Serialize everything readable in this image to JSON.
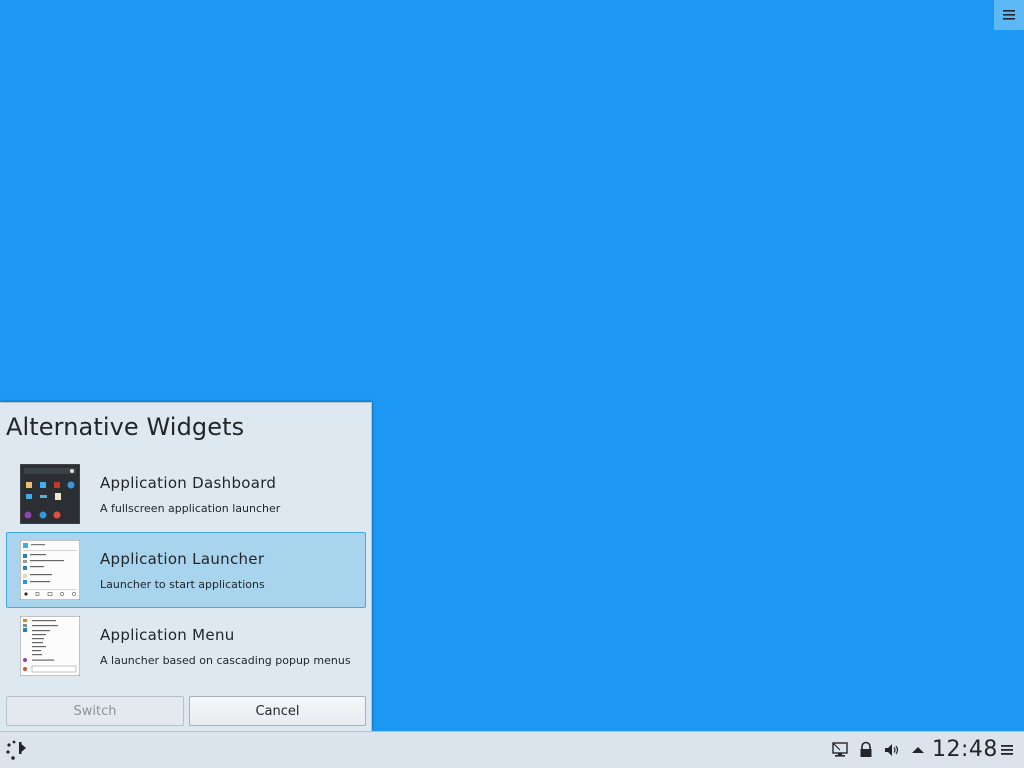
{
  "popup": {
    "title": "Alternative Widgets",
    "items": [
      {
        "name": "Application Dashboard",
        "description": "A fullscreen application launcher",
        "selected": false
      },
      {
        "name": "Application Launcher",
        "description": "Launcher to start applications",
        "selected": true
      },
      {
        "name": "Application Menu",
        "description": "A launcher based on cascading popup menus",
        "selected": false
      }
    ],
    "buttons": {
      "switch": "Switch",
      "cancel": "Cancel"
    }
  },
  "panel": {
    "clock": "12:48",
    "tray_icons": [
      "network-icon",
      "lock-icon",
      "volume-icon",
      "expand-tray-icon"
    ]
  },
  "colors": {
    "desktop": "#1d99f3",
    "selection": "#a8d4ee",
    "accent": "#3daee9"
  }
}
